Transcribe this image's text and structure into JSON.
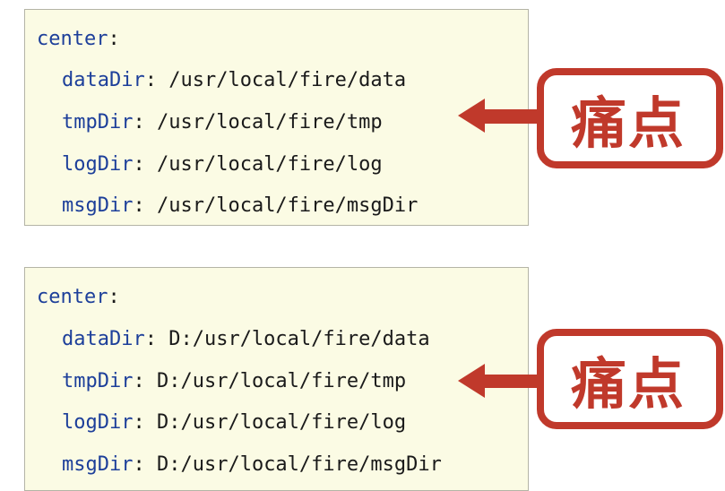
{
  "blocks": [
    {
      "root_key": "center",
      "root_colon": ":",
      "entries": [
        {
          "key": "dataDir",
          "sep": ": ",
          "value": "/usr/local/fire/data"
        },
        {
          "key": "tmpDir",
          "sep": ": ",
          "value": "/usr/local/fire/tmp"
        },
        {
          "key": "logDir",
          "sep": ": ",
          "value": "/usr/local/fire/log"
        },
        {
          "key": "msgDir",
          "sep": ": ",
          "value": "/usr/local/fire/msgDir"
        }
      ],
      "callout": {
        "label": "痛点"
      }
    },
    {
      "root_key": "center",
      "root_colon": ":",
      "entries": [
        {
          "key": "dataDir",
          "sep": ": ",
          "value": "D:/usr/local/fire/data"
        },
        {
          "key": "tmpDir",
          "sep": ": ",
          "value": "D:/usr/local/fire/tmp"
        },
        {
          "key": "logDir",
          "sep": ": ",
          "value": "D:/usr/local/fire/log"
        },
        {
          "key": "msgDir",
          "sep": ": ",
          "value": "D:/usr/local/fire/msgDir"
        }
      ],
      "callout": {
        "label": "痛点"
      }
    }
  ],
  "colors": {
    "code_background": "#fbfbe4",
    "code_border": "#b4b4a6",
    "key": "#1d3f9a",
    "text": "#1a1a1a",
    "accent_red": "#c0392b"
  },
  "icons": [
    "left-arrow-icon"
  ]
}
